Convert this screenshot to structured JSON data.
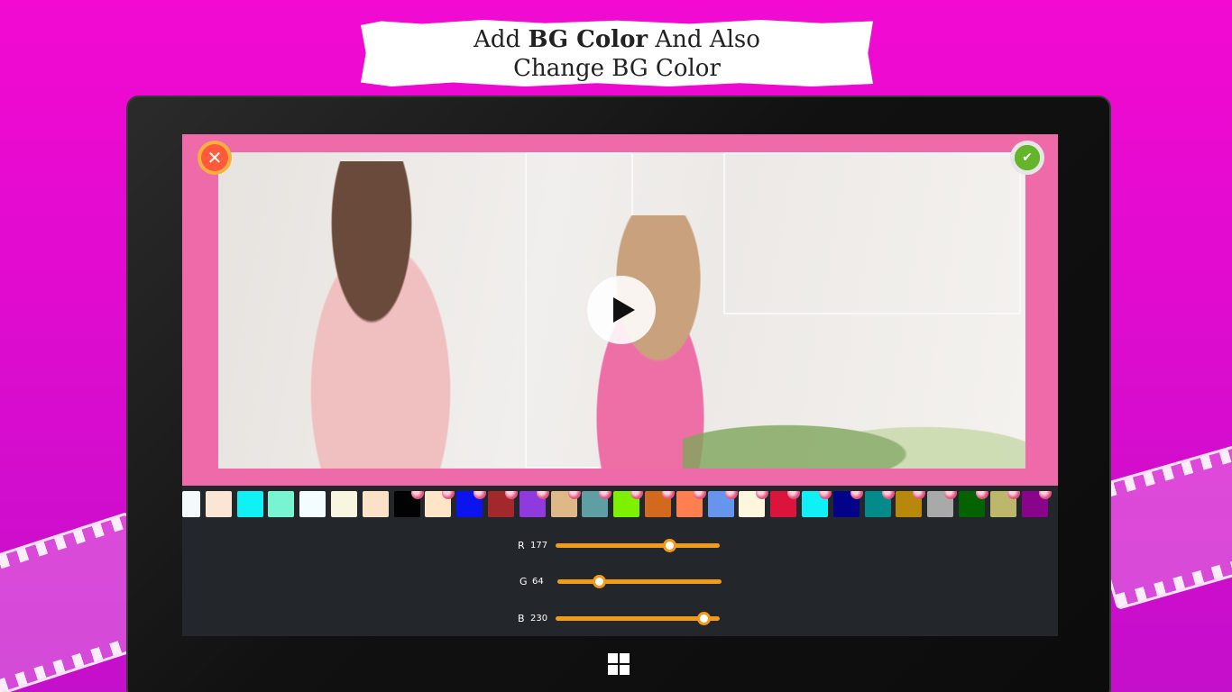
{
  "banner": {
    "line1_pre": "Add",
    "line1_bold": "BG Color",
    "line1_post": "And Also",
    "line2": "Change BG Color"
  },
  "editor": {
    "close_icon": "close-icon",
    "confirm_icon": "check-icon",
    "play_icon": "play-icon"
  },
  "swatches": [
    {
      "color": "#f4f9fb",
      "dot": false
    },
    {
      "color": "#fbe6d5",
      "dot": false
    },
    {
      "color": "#10f1f6",
      "dot": false
    },
    {
      "color": "#77f5d1",
      "dot": false
    },
    {
      "color": "#f3fcff",
      "dot": false
    },
    {
      "color": "#f8f6df",
      "dot": false
    },
    {
      "color": "#fbe1c6",
      "dot": false
    },
    {
      "color": "#020202",
      "dot": true
    },
    {
      "color": "#fde6c8",
      "dot": true
    },
    {
      "color": "#0b14ee",
      "dot": true
    },
    {
      "color": "#a2282c",
      "dot": true
    },
    {
      "color": "#8e3adf",
      "dot": true
    },
    {
      "color": "#dfb888",
      "dot": true
    },
    {
      "color": "#5f9ea3",
      "dot": true
    },
    {
      "color": "#7df100",
      "dot": true
    },
    {
      "color": "#d2691e",
      "dot": true
    },
    {
      "color": "#ff7f50",
      "dot": true
    },
    {
      "color": "#6595ec",
      "dot": true
    },
    {
      "color": "#fff7dd",
      "dot": true
    },
    {
      "color": "#db143c",
      "dot": true
    },
    {
      "color": "#0ff1f7",
      "dot": true
    },
    {
      "color": "#03038a",
      "dot": true
    },
    {
      "color": "#038a8b",
      "dot": true
    },
    {
      "color": "#b8880b",
      "dot": true
    },
    {
      "color": "#a9a9a9",
      "dot": true
    },
    {
      "color": "#036300",
      "dot": true
    },
    {
      "color": "#bcb76b",
      "dot": true
    },
    {
      "color": "#8a038b",
      "dot": true
    }
  ],
  "sliders": {
    "r": {
      "label": "R",
      "value": "177",
      "fraction": 0.694
    },
    "g": {
      "label": "G",
      "value": "64",
      "fraction": 0.251
    },
    "b": {
      "label": "B",
      "value": "230",
      "fraction": 0.902
    }
  },
  "colors": {
    "background": "#e10bcf",
    "frame_pink": "#ef6aa8",
    "slider_accent": "#f39a17",
    "panel_dark": "#23262b"
  },
  "os": {
    "start_icon": "windows-logo-icon"
  }
}
